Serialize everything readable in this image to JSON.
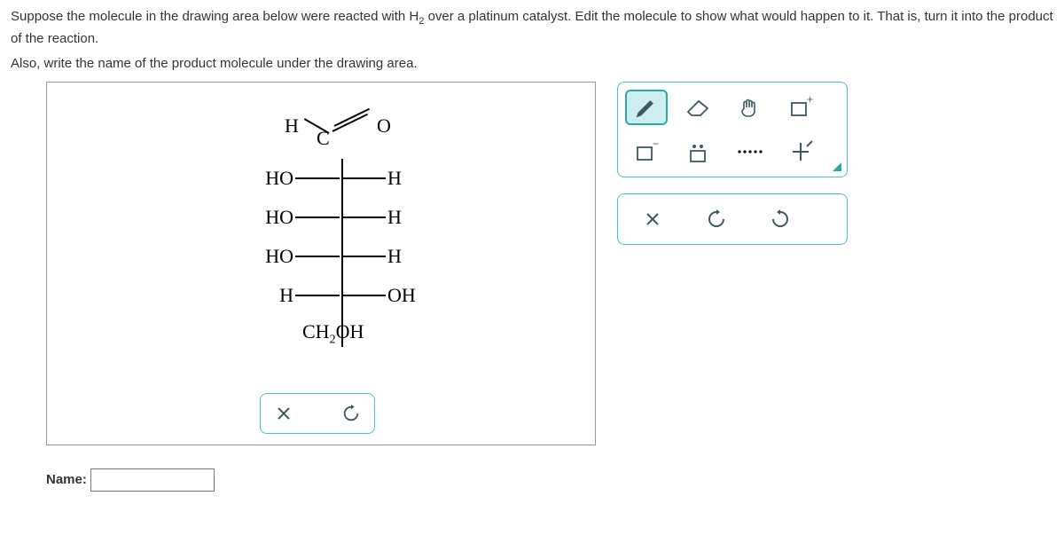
{
  "question": {
    "line1_a": "Suppose the molecule in the drawing area below were reacted with ",
    "h2": "H",
    "h2_sub": "2",
    "line1_b": " over a platinum catalyst. Edit the molecule to show what would happen to it. That is, turn it into the product of the reaction.",
    "line2": "Also, write the name of the product molecule under the drawing area."
  },
  "molecule": {
    "top_H": "H",
    "top_C": "C",
    "top_O": "O",
    "rows": [
      {
        "left": "HO",
        "right": "H"
      },
      {
        "left": "HO",
        "right": "H"
      },
      {
        "left": "HO",
        "right": "H"
      },
      {
        "left": "H",
        "right": "OH"
      }
    ],
    "bottom_a": "CH",
    "bottom_sub": "2",
    "bottom_b": "OH"
  },
  "name_field": {
    "label": "Name:",
    "value": ""
  },
  "toolbar1": {
    "pencil": "pencil-icon",
    "eraser": "eraser-icon",
    "hand": "hand-icon",
    "new": "new-box-icon",
    "charge": "charge-box-icon",
    "lonepair": "lone-pair-icon",
    "dots": "dots-icon",
    "chiral": "chiral-icon"
  },
  "toolbar2": {
    "close": "close-icon",
    "undo": "undo-icon",
    "redo": "redo-icon"
  },
  "inline_tools": {
    "clear": "clear-icon",
    "reset": "reset-icon"
  }
}
